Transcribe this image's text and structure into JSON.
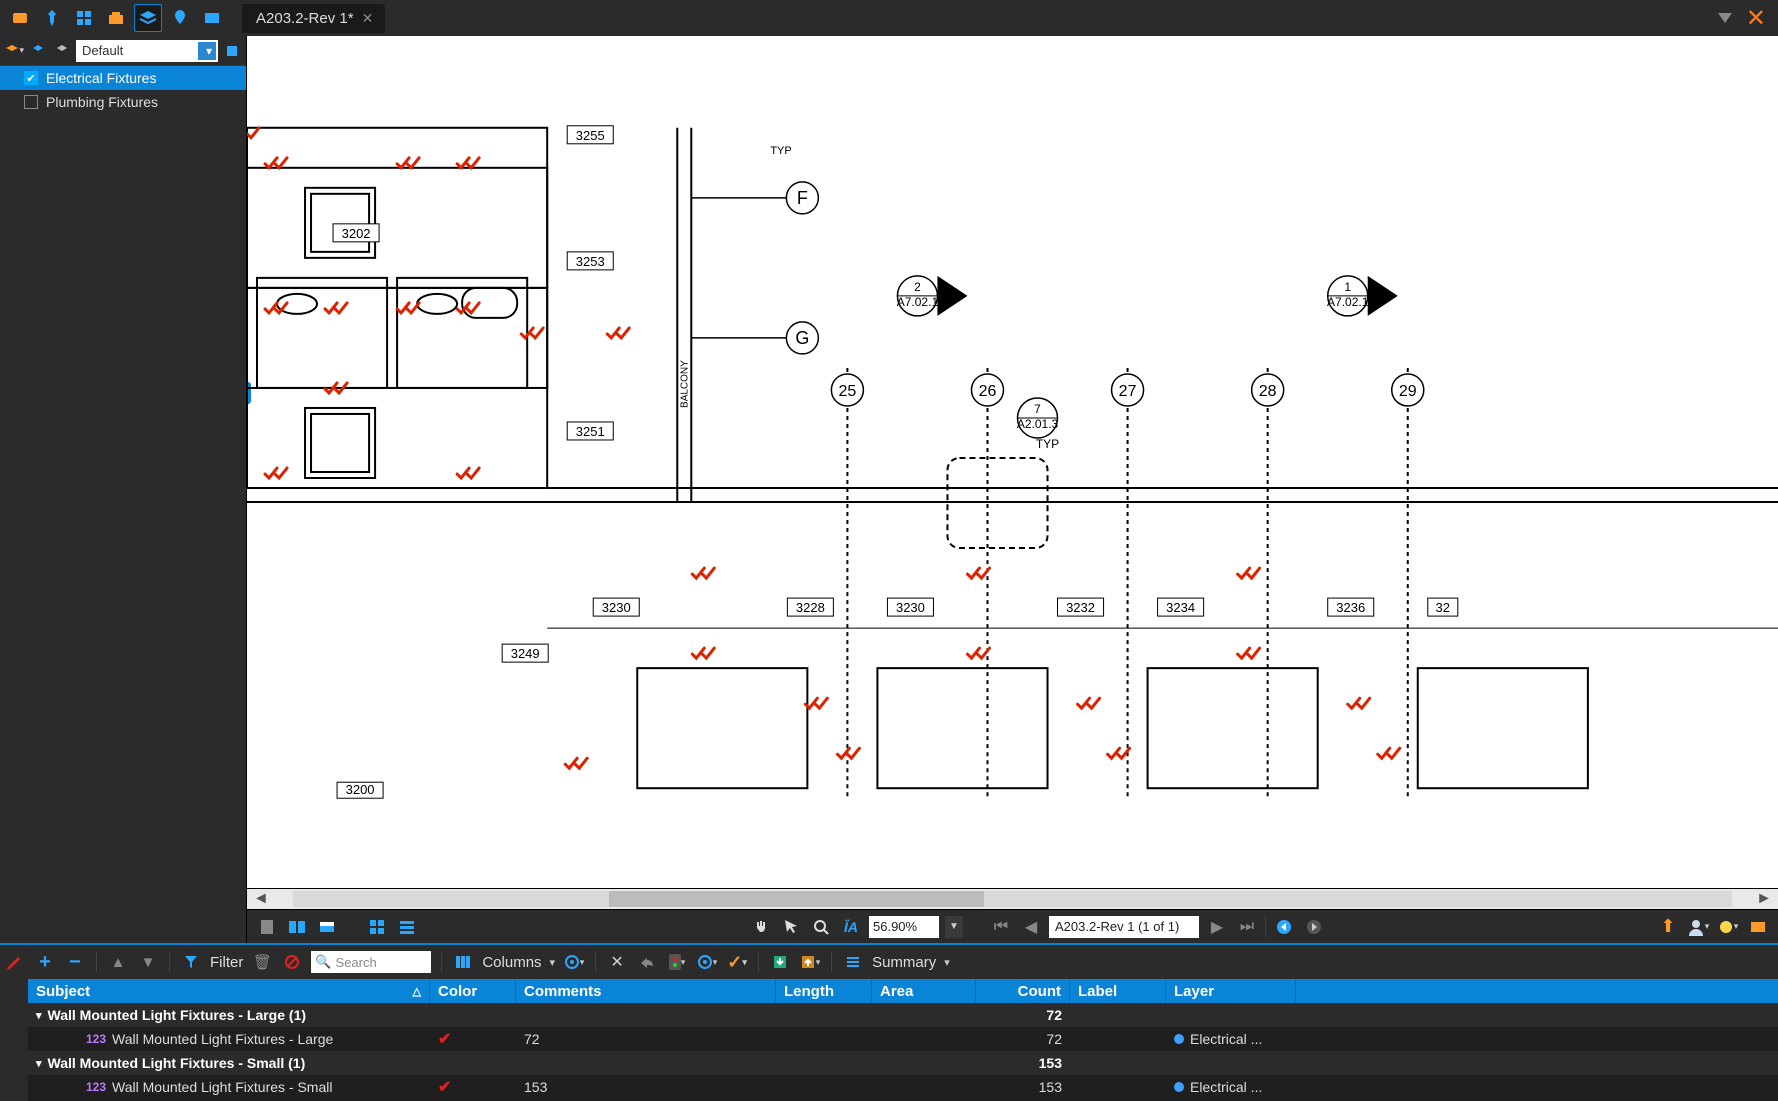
{
  "tabs": {
    "active": "A203.2-Rev 1*"
  },
  "sidebar": {
    "profile": "Default",
    "items": [
      {
        "label": "Electrical Fixtures",
        "checked": true,
        "selected": true
      },
      {
        "label": "Plumbing Fixtures",
        "checked": false,
        "selected": false
      }
    ]
  },
  "drawing": {
    "grid_letters": [
      "F",
      "G"
    ],
    "grid_numbers": [
      "25",
      "26",
      "27",
      "28",
      "29"
    ],
    "detail_refs": [
      {
        "num": "2",
        "sheet": "A7.02.1"
      },
      {
        "num": "1",
        "sheet": "A7.02.1"
      },
      {
        "num": "7",
        "sheet": "A2.01.3",
        "note": "TYP"
      }
    ],
    "room_tags_top": [
      "3255",
      "3202",
      "3253",
      "3251"
    ],
    "room_tags_bottom": [
      "3230",
      "3228",
      "3230",
      "3232",
      "3234",
      "3236",
      "32",
      "3249",
      "3200"
    ],
    "balcony_label": "BALCONY",
    "typ_note": "TYP"
  },
  "viewbar": {
    "zoom": "56.90%",
    "doc_nav": "A203.2-Rev 1 (1 of 1)"
  },
  "markups": {
    "toolbar": {
      "filter_label": "Filter",
      "search_placeholder": "Search",
      "columns_label": "Columns",
      "summary_label": "Summary"
    },
    "columns": [
      "Subject",
      "Color",
      "Comments",
      "Length",
      "Area",
      "Count",
      "Label",
      "Layer"
    ],
    "sort_asc_on": "Subject",
    "groups": [
      {
        "title": "Wall Mounted Light Fixtures - Large (1)",
        "count": "72",
        "items": [
          {
            "prefix": "123",
            "subject": "Wall Mounted Light Fixtures - Large",
            "comments": "72",
            "count": "72",
            "layer": "Electrical ..."
          }
        ]
      },
      {
        "title": "Wall Mounted Light Fixtures - Small (1)",
        "count": "153",
        "items": [
          {
            "prefix": "123",
            "subject": "Wall Mounted Light Fixtures - Small",
            "comments": "153",
            "count": "153",
            "layer": "Electrical ..."
          }
        ]
      }
    ]
  }
}
